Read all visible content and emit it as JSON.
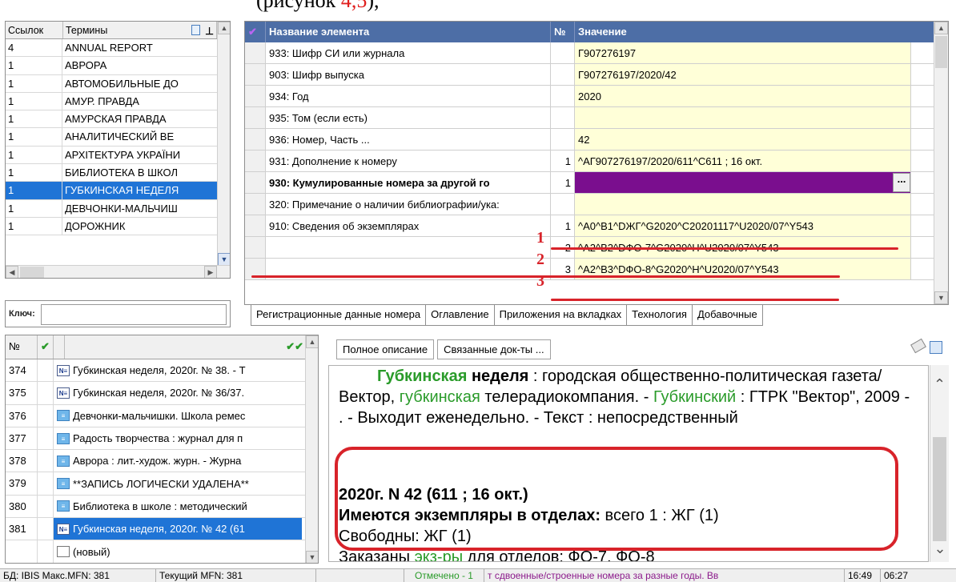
{
  "top_caption": {
    "prefix": "(рисунок ",
    "red": "4,5",
    "suffix": "),"
  },
  "terms": {
    "col_links": "Ссылок",
    "col_terms": "Термины",
    "rows": [
      {
        "count": "4",
        "term": "ANNUAL REPORT"
      },
      {
        "count": "1",
        "term": "АВРОРА"
      },
      {
        "count": "1",
        "term": "АВТОМОБИЛЬНЫЕ ДО"
      },
      {
        "count": "1",
        "term": "АМУР. ПРАВДА"
      },
      {
        "count": "1",
        "term": "АМУРСКАЯ ПРАВДА"
      },
      {
        "count": "1",
        "term": "АНАЛИТИЧЕСКИЙ ВЕ"
      },
      {
        "count": "1",
        "term": "АРХІТЕКТУРА УКРАЇНИ"
      },
      {
        "count": "1",
        "term": "БИБЛИОТЕКА В ШКОЛ"
      },
      {
        "count": "1",
        "term": "ГУБКИНСКАЯ НЕДЕЛЯ"
      },
      {
        "count": "1",
        "term": "ДЕВЧОНКИ-МАЛЬЧИШ"
      },
      {
        "count": "1",
        "term": "ДОРОЖНИК"
      }
    ],
    "key_label": "Ключ:"
  },
  "grid": {
    "col_name": "Название элемента",
    "col_num": "№",
    "col_value": "Значение",
    "rows": [
      {
        "name": "933: Шифр СИ или журнала",
        "num": "",
        "value": "Г907276197",
        "bold": false
      },
      {
        "name": "903: Шифр выпуска",
        "num": "",
        "value": "Г907276197/2020/42",
        "bold": false
      },
      {
        "name": "934: Год",
        "num": "",
        "value": "2020",
        "bold": false
      },
      {
        "name": "935: Том (если есть)",
        "num": "",
        "value": "",
        "bold": false
      },
      {
        "name": "936: Номер, Часть ...",
        "num": "",
        "value": "42",
        "bold": false
      },
      {
        "name": "931: Дополнение к номеру",
        "num": "1",
        "value": "^АГ907276197/2020/611^С611 ; 16 окт.",
        "bold": false
      },
      {
        "name": "930: Кумулированные номера за другой го",
        "num": "1",
        "value": "",
        "bold": true
      },
      {
        "name": "320: Примечание о наличии библиографии/ука:",
        "num": "",
        "value": "",
        "bold": false
      },
      {
        "name": "910: Сведения об экземплярах",
        "num": "1",
        "value": "^A0^B1^DЖГ^G2020^C20201117^U2020/07^Y543",
        "bold": false
      },
      {
        "name": "",
        "num": "2",
        "value": "^A2^B2^DФО-7^G2020^H^U2020/07^Y543",
        "bold": false
      },
      {
        "name": "",
        "num": "3",
        "value": "^A2^B3^DФО-8^G2020^H^U2020/07^Y543",
        "bold": false
      }
    ],
    "marks": [
      "1",
      "2",
      "3"
    ],
    "tabs": [
      "Регистрационные данные номера",
      "Оглавление",
      "Приложения на вкладках",
      "Технология",
      "Добавочные"
    ]
  },
  "records": {
    "col_no": "№",
    "rows": [
      {
        "no": "374",
        "icon": "nb",
        "title": "Губкинская неделя, 2020г. № 38. - Т"
      },
      {
        "no": "375",
        "icon": "nb",
        "title": "Губкинская неделя, 2020г. № 36/37."
      },
      {
        "no": "376",
        "icon": "doc",
        "title": "Девчонки-мальчишки. Школа ремес"
      },
      {
        "no": "377",
        "icon": "doc",
        "title": "Радость творчества : журнал для п"
      },
      {
        "no": "378",
        "icon": "doc",
        "title": "Аврора : лит.-худож. журн. - Журна"
      },
      {
        "no": "379",
        "icon": "doc",
        "title": "**ЗАПИСЬ ЛОГИЧЕСКИ УДАЛЕНА**"
      },
      {
        "no": "380",
        "icon": "doc",
        "title": "Библиотека в школе : методический"
      },
      {
        "no": "381",
        "icon": "nb",
        "title": "Губкинская неделя, 2020г. № 42 (61"
      },
      {
        "no": "",
        "icon": "blank",
        "title": "(новый)"
      }
    ]
  },
  "desc": {
    "tab_full": "Полное описание",
    "tab_linked": "Связанные док-ты ...",
    "title_green": "Губкинская",
    "title_bold": "неделя",
    "text1": " : городская общественно-политическая газета/ Вектор, ",
    "text1_green": "губкинская",
    "text1b": " телерадиокомпания. - ",
    "text1_green2": "Губкинский",
    "text1c": " : ГТРК \"Вектор\", 2009 - . - Выходит еженедельно. - Текст : непосредственный",
    "issue": "2020г. N 42 (611 ; 16 окт.)",
    "copies_label": "Имеются экземпляры в отделах:",
    "copies_text": " всего 1 : ЖГ (1)",
    "free": "Свободны: ЖГ (1)",
    "ordered_pre": "Заказаны ",
    "ordered_green": "экз-ры",
    "ordered_post": " для отделов: ФО-7, ФО-8"
  },
  "status": {
    "db": "БД: IBIS Макс.MFN: 381",
    "current": "Текущий MFN: 381",
    "marked": "Отмечено - 1",
    "message": "т сдвоенные/строенные номера за разные годы. Вв",
    "time1": "16:49",
    "time2": "06:27"
  }
}
